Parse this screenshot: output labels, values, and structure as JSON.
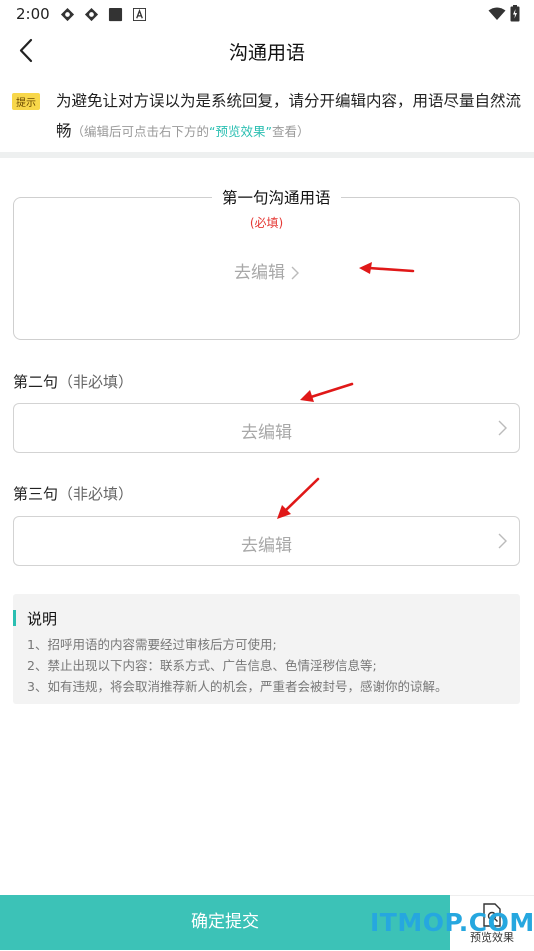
{
  "status_bar": {
    "time": "2:00"
  },
  "header": {
    "title": "沟通用语"
  },
  "tip": {
    "badge": "提示",
    "text": "为避免让对方误以为是系统回复，请分开编辑内容，用语尽量自然流畅",
    "sub_prefix": "（编辑后可点击右下方的",
    "sub_link": "“预览效果”",
    "sub_suffix": "查看）"
  },
  "sentence1": {
    "legend": "第一句沟通用语",
    "required": "(必填)",
    "edit": "去编辑"
  },
  "sentence2": {
    "label": "第二句",
    "optional": "（非必填）",
    "edit": "去编辑"
  },
  "sentence3": {
    "label": "第三句",
    "optional": "（非必填）",
    "edit": "去编辑"
  },
  "notes": {
    "title": "说明",
    "lines": [
      "1、招呼用语的内容需要经过审核后方可使用;",
      "2、禁止出现以下内容：联系方式、广告信息、色情淫秽信息等;",
      "3、如有违规，将会取消推荐新人的机会，严重者会被封号，感谢你的谅解。"
    ]
  },
  "footer": {
    "submit": "确定提交",
    "preview": "预览效果",
    "watermark": "ITMOP.COM"
  },
  "colors": {
    "accent": "#3cc2b7",
    "required": "#e53935",
    "arrow": "#e01818",
    "badge": "#f8d74a"
  }
}
